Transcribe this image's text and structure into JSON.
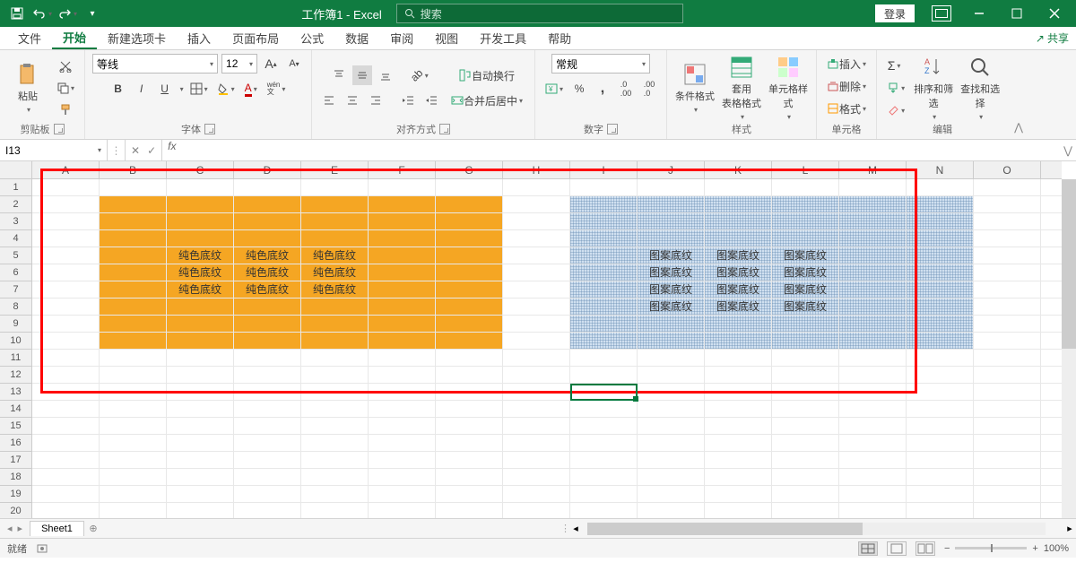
{
  "app": {
    "title": "工作簿1  -  Excel",
    "search_placeholder": "搜索",
    "login": "登录"
  },
  "tabs": {
    "file": "文件",
    "home": "开始",
    "newtab": "新建选项卡",
    "insert": "插入",
    "pagelayout": "页面布局",
    "formulas": "公式",
    "data": "数据",
    "review": "审阅",
    "view": "视图",
    "developer": "开发工具",
    "help": "帮助",
    "share": "共享"
  },
  "ribbon": {
    "clipboard": {
      "paste": "粘贴",
      "label": "剪贴板"
    },
    "font": {
      "name": "等线",
      "size": "12",
      "bold": "B",
      "italic": "I",
      "underline": "U",
      "pinyin": "wén",
      "pinyin2": "文",
      "label": "字体"
    },
    "align": {
      "wrap": "自动换行",
      "merge": "合并后居中",
      "label": "对齐方式"
    },
    "number": {
      "format": "常规",
      "label": "数字"
    },
    "styles": {
      "cond": "条件格式",
      "table": "套用\n表格格式",
      "cell": "单元格样式",
      "label": "样式"
    },
    "cells": {
      "insert": "插入",
      "delete": "删除",
      "format": "格式",
      "label": "单元格"
    },
    "editing": {
      "sort": "排序和筛选",
      "find": "查找和选择",
      "label": "编辑"
    }
  },
  "fbar": {
    "nameref": "I13"
  },
  "cols": [
    "A",
    "B",
    "C",
    "D",
    "E",
    "F",
    "G",
    "H",
    "I",
    "J",
    "K",
    "L",
    "M",
    "N",
    "O"
  ],
  "rows": [
    "1",
    "2",
    "3",
    "4",
    "5",
    "6",
    "7",
    "8",
    "9",
    "10",
    "11",
    "12",
    "13",
    "14",
    "15",
    "16",
    "17",
    "18",
    "19",
    "20"
  ],
  "content": {
    "solid": "纯色底纹",
    "pattern": "图案底纹",
    "solid_block": {
      "row_start": 2,
      "row_end": 10,
      "col_start": 1,
      "col_end": 6
    },
    "pattern_block": {
      "row_start": 2,
      "row_end": 10,
      "col_start": 8,
      "col_end": 13
    },
    "solid_text_cells": [
      {
        "r": 5,
        "c": 2
      },
      {
        "r": 5,
        "c": 3
      },
      {
        "r": 5,
        "c": 4
      },
      {
        "r": 6,
        "c": 2
      },
      {
        "r": 6,
        "c": 3
      },
      {
        "r": 6,
        "c": 4
      },
      {
        "r": 7,
        "c": 2
      },
      {
        "r": 7,
        "c": 3
      },
      {
        "r": 7,
        "c": 4
      }
    ],
    "pattern_text_cells": [
      {
        "r": 5,
        "c": 9
      },
      {
        "r": 5,
        "c": 10
      },
      {
        "r": 5,
        "c": 11
      },
      {
        "r": 6,
        "c": 9
      },
      {
        "r": 6,
        "c": 10
      },
      {
        "r": 6,
        "c": 11
      },
      {
        "r": 7,
        "c": 9
      },
      {
        "r": 7,
        "c": 10
      },
      {
        "r": 7,
        "c": 11
      },
      {
        "r": 8,
        "c": 9
      },
      {
        "r": 8,
        "c": 10
      },
      {
        "r": 8,
        "c": 11
      }
    ]
  },
  "sheet": {
    "name": "Sheet1"
  },
  "status": {
    "ready": "就绪",
    "zoom": "100%"
  }
}
